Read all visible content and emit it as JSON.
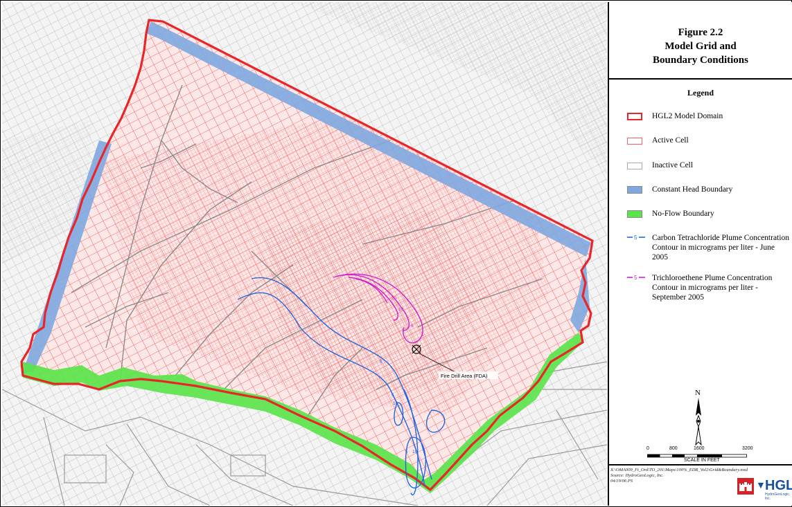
{
  "figure": {
    "title_line1": "Figure 2.2",
    "title_line2": "Model Grid and",
    "title_line3": "Boundary Conditions"
  },
  "legend": {
    "title": "Legend",
    "items": [
      {
        "label": "HGL2 Model Domain",
        "color": "#e8262a"
      },
      {
        "label": "Active Cell",
        "color": "#f06060"
      },
      {
        "label": "Inactive Cell",
        "color": "#a8a8a8"
      },
      {
        "label": "Constant Head Boundary",
        "color": "#80a8e0"
      },
      {
        "label": "No-Flow Boundary",
        "color": "#5be34a"
      },
      {
        "label": "Carbon Tetrachloride Plume Concentration Contour in micrograms per liter - June 2005",
        "color": "#2266dd",
        "sample": "5"
      },
      {
        "label": "Trichloroethene Plume Concentration Contour in micrograms per liter - September 2005",
        "color": "#cc22cc",
        "sample": "5"
      }
    ]
  },
  "map": {
    "fda_label": "Fire Drill Area (FDA)",
    "contour_labels": [
      "20",
      "10",
      "5",
      "1",
      "5",
      "5",
      "10",
      "5",
      "10"
    ]
  },
  "north": {
    "label": "N"
  },
  "scale": {
    "ticks": [
      "0",
      "800",
      "1600",
      "3200"
    ],
    "caption": "SCALE IN FEET"
  },
  "source": {
    "path": "X:\\OMA009_Ft_Ord\\TO_201\\Maps\\100%_EDR_Vol2\\Grid&Boundary.mxd",
    "credit": "Source: HydroGeoLogic, Inc.",
    "date": "04/19/06 PS"
  },
  "logos": {
    "hgl_word": "HGL",
    "hgl_sub": "HydroGeoLogic, Inc."
  }
}
